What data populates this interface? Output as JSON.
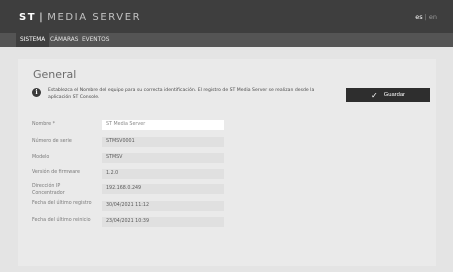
{
  "header": {
    "logo_st": "ST",
    "logo_sep": "|",
    "logo_ms": "MEDIA SERVER",
    "lang_active": "es",
    "lang_divider": "|",
    "lang_other": "en"
  },
  "tabs": [
    {
      "label": "SISTEMA",
      "active": true
    },
    {
      "label": "CÁMARAS",
      "active": false
    },
    {
      "label": "EVENTOS",
      "active": false
    }
  ],
  "main": {
    "title": "General",
    "info_icon": "info-icon",
    "info_text": "Establezca el Nombre del equipo para su correcta identificación. El registro de ST Media Server se realizan desde la aplicación ST Console.",
    "save_label": "Guardar",
    "fields": [
      {
        "label": "Nombre *",
        "value": "ST Media Server"
      },
      {
        "label": "Número de serie",
        "value": "STMSV0001"
      },
      {
        "label": "Modelo",
        "value": "STMSV"
      },
      {
        "label": "Versión de firmware",
        "value": "1.2.0"
      },
      {
        "label": "Dirección IP Concentrador",
        "value": "192.168.0.249"
      },
      {
        "label": "Fecha del último registro",
        "value": "30/04/2021 11:12"
      },
      {
        "label": "Fecha del último reinicio",
        "value": "23/04/2021 10:39"
      }
    ]
  },
  "colors": {
    "topbar": "#3e3e3e",
    "tabbar": "#545454",
    "active_tab": "#3f3f3f",
    "page_bg": "#e4e4e4",
    "panel_bg": "#eaeaea",
    "button_bg": "#2e2e2e"
  }
}
